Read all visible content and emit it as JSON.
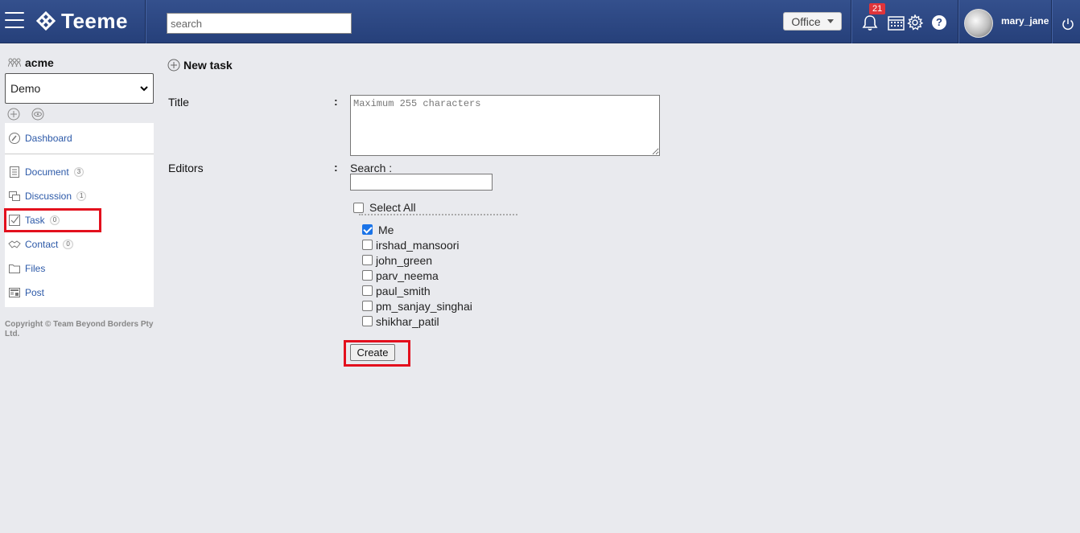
{
  "header": {
    "app_name": "Teeme",
    "search_placeholder": "search",
    "office_label": "Office",
    "notification_count": "21",
    "help_label": "?",
    "username": "mary_jane"
  },
  "sidebar": {
    "org_name": "acme",
    "workspace": "Demo",
    "items": [
      {
        "label": "Dashboard",
        "count": null
      },
      {
        "label": "Document",
        "count": "3"
      },
      {
        "label": "Discussion",
        "count": "1"
      },
      {
        "label": "Task",
        "count": "0"
      },
      {
        "label": "Contact",
        "count": "0"
      },
      {
        "label": "Files",
        "count": null
      },
      {
        "label": "Post",
        "count": null
      }
    ],
    "copyright": "Copyright © Team Beyond Borders Pty Ltd."
  },
  "form": {
    "page_title": "New task",
    "title_label": "Title",
    "title_placeholder": "Maximum 255 characters",
    "editors_label": "Editors",
    "colon": ":",
    "search_label": "Search :",
    "select_all_label": "Select All",
    "editors": [
      {
        "name": "Me",
        "checked": true
      },
      {
        "name": "irshad_mansoori",
        "checked": false
      },
      {
        "name": "john_green",
        "checked": false
      },
      {
        "name": "parv_neema",
        "checked": false
      },
      {
        "name": "paul_smith",
        "checked": false
      },
      {
        "name": "pm_sanjay_singhai",
        "checked": false
      },
      {
        "name": "shikhar_patil",
        "checked": false
      }
    ],
    "create_label": "Create"
  },
  "colors": {
    "header_bg": "#2b4684",
    "link": "#2c59a8",
    "highlight": "#e3101d",
    "badge": "#e0343a"
  }
}
